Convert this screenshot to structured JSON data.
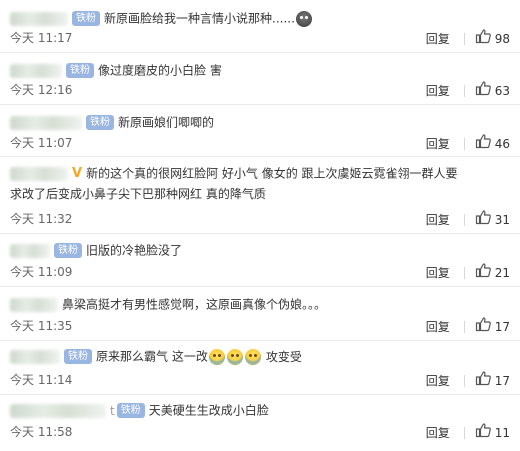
{
  "reply_label": "回复",
  "comments": [
    {
      "badge": "铁粉",
      "text": "新原画脸给我一种言情小说那种......",
      "time": "今天 11:17",
      "likes": "98",
      "emoji": "dark-face"
    },
    {
      "badge": "铁粉",
      "text": "像过度磨皮的小白脸 害",
      "time": "今天 12:16",
      "likes": "63"
    },
    {
      "badge": "铁粉",
      "text": "新原画娘们唧唧的",
      "time": "今天 11:07",
      "likes": "46"
    },
    {
      "badge": "",
      "vip": "V",
      "text": "新的这个真的很网红脸阿 好小气 像女的 跟上次虞姬云霓雀翎一群人要",
      "text2": "求改了后变成小鼻子尖下巴那种网红  真的降气质",
      "time": "今天 11:32",
      "likes": "31"
    },
    {
      "badge": "铁粉",
      "text": "旧版的冷艳脸没了",
      "time": "今天 11:09",
      "likes": "21"
    },
    {
      "badge": "",
      "text": "鼻梁高挺才有男性感觉啊，这原画真像个伪娘。。。",
      "time": "今天 11:35",
      "likes": "17"
    },
    {
      "badge": "铁粉",
      "text": "原来那么霸气 这一改",
      "text_after": "攻变受",
      "time": "今天 11:14",
      "likes": "17",
      "emoji": "crying-laughing-face x3"
    },
    {
      "badge": "铁粉",
      "name_tail": "t",
      "text": "天美硬生生改成小白脸",
      "time": "今天 11:58",
      "likes": "11"
    }
  ]
}
